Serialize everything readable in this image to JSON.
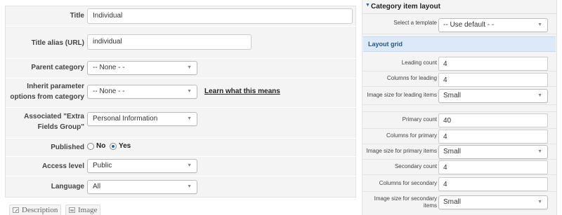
{
  "form": {
    "title": {
      "label": "Title",
      "value": "Individual"
    },
    "alias": {
      "label": "Title alias (URL)",
      "value": "individual"
    },
    "parent_category": {
      "label": "Parent category",
      "value": "-- None - -"
    },
    "inherit": {
      "label_line1": "Inherit parameter",
      "label_line2": "options from category",
      "value": "-- None - -",
      "link": "Learn what this means"
    },
    "extra_fields": {
      "label_line1": "Associated \"Extra",
      "label_line2": "Fields Group\"",
      "value": "Personal Information"
    },
    "published": {
      "label": "Published",
      "options": [
        "No",
        "Yes"
      ],
      "selected": "Yes"
    },
    "access_level": {
      "label": "Access level",
      "value": "Public"
    },
    "language": {
      "label": "Language",
      "value": "All"
    }
  },
  "tabs": [
    "Description",
    "Image"
  ],
  "panel": {
    "title": "Category item layout",
    "template": {
      "label": "Select a template",
      "value": "-- Use default - -"
    },
    "layout_grid_title": "Layout grid",
    "leading_count": {
      "label": "Leading count",
      "value": "4"
    },
    "columns_leading": {
      "label": "Columns for leading",
      "value": "4"
    },
    "image_size_leading": {
      "label": "Image size for leading items",
      "value": "Small"
    },
    "primary_count": {
      "label": "Primary count",
      "value": "40"
    },
    "columns_primary": {
      "label": "Columns for primary",
      "value": "4"
    },
    "image_size_primary": {
      "label": "Image size for primary items",
      "value": "Small"
    },
    "secondary_count": {
      "label": "Secondary count",
      "value": "4"
    },
    "columns_secondary": {
      "label": "Columns for secondary",
      "value": "4"
    },
    "image_size_secondary": {
      "label_line1": "Image size for secondary",
      "label_line2": "items",
      "value": "Small"
    }
  },
  "colors": {
    "accent": "#1565c0",
    "grid_heading_bg": "#dbe9f8",
    "panel_bg": "#f4f4f4"
  },
  "icons": {
    "dropdown": "chevron-down-icon",
    "collapse": "caret-down-icon",
    "description_tab": "pencil-icon",
    "image_tab": "image-icon"
  }
}
